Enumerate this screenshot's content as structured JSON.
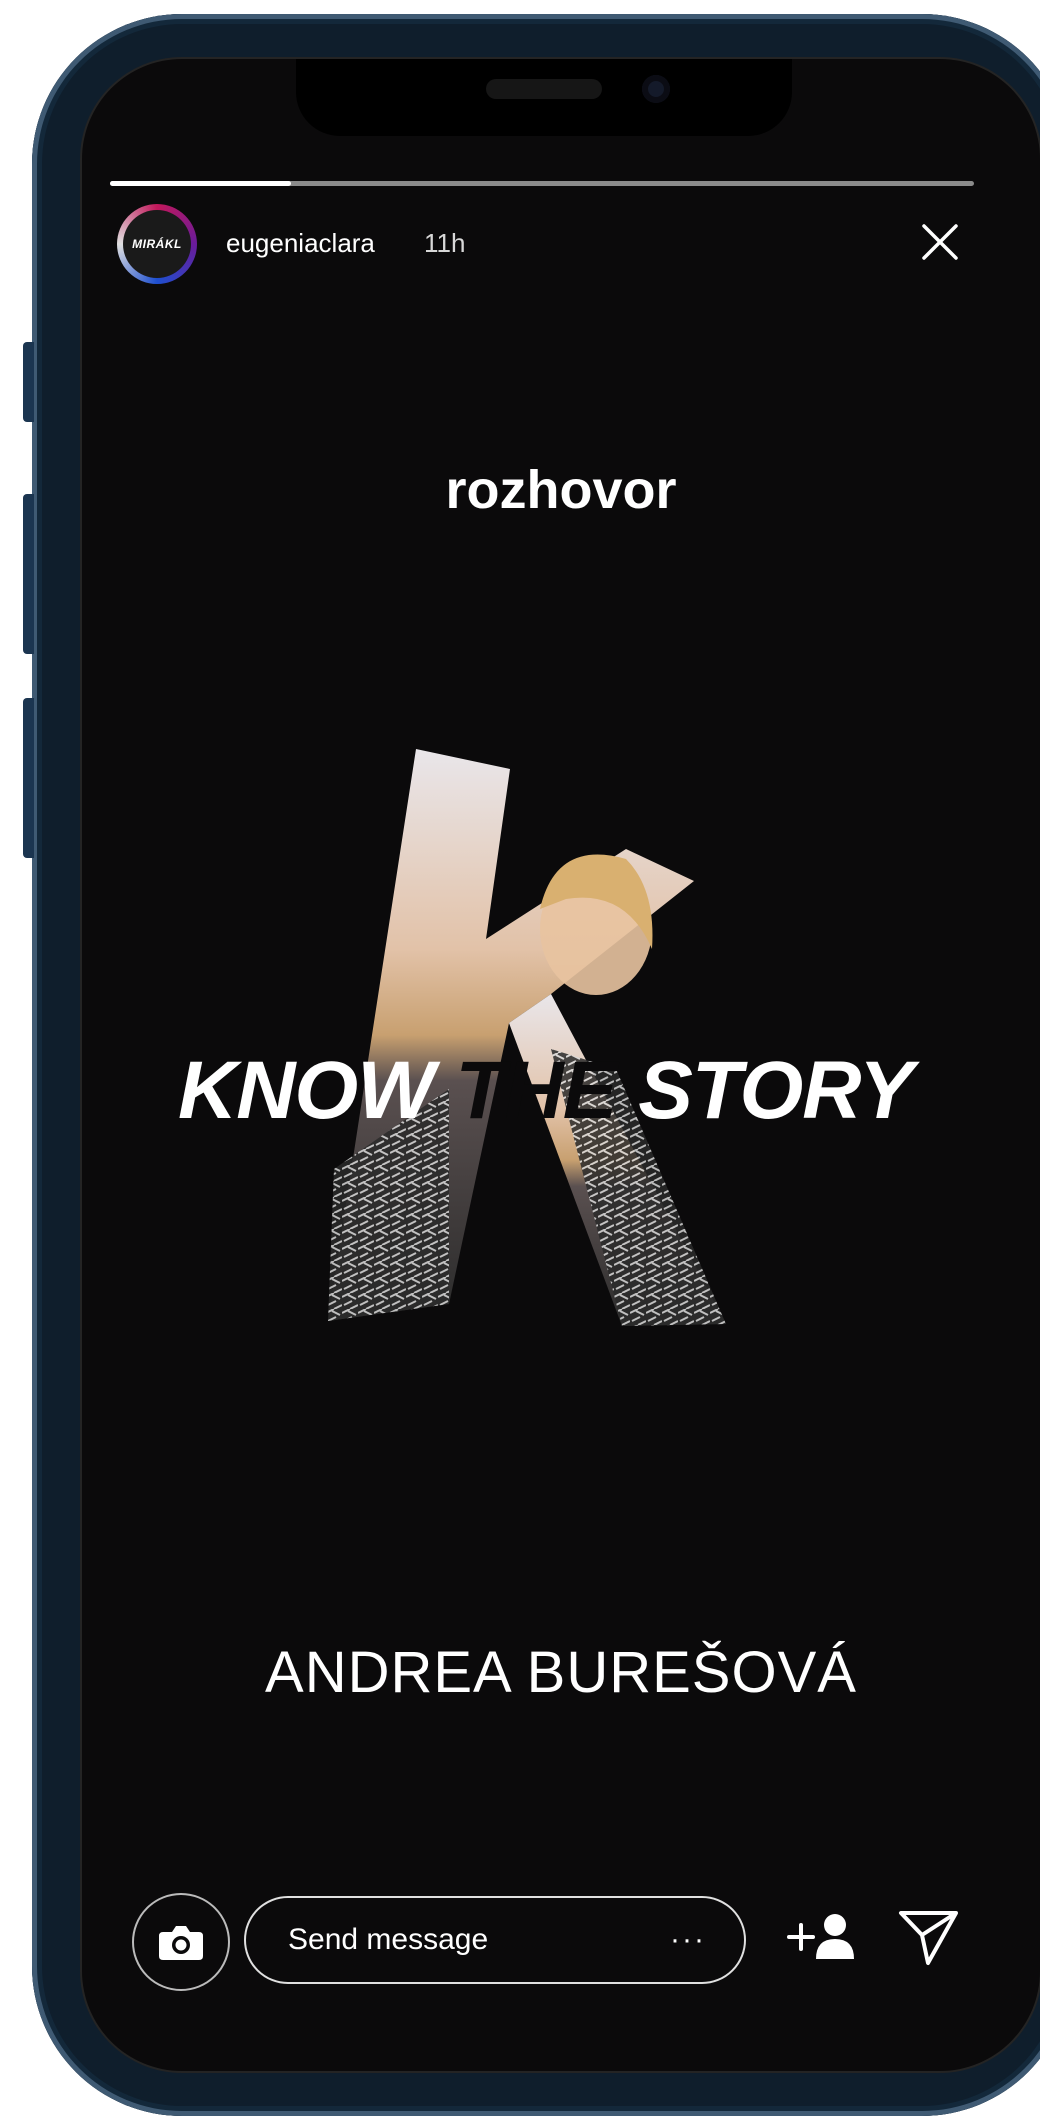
{
  "story": {
    "progress_fraction": 0.21,
    "user": {
      "avatar_text": "MIRÁKL",
      "username": "eugeniaclara",
      "time_ago": "11h"
    },
    "title": "rozhovor",
    "headline": {
      "part1": "KNOW",
      "part2": " THE",
      "part3": " STORY"
    },
    "person_name": "ANDREA BUREŠOVÁ"
  },
  "composer": {
    "placeholder": "Send message",
    "more_label": "···"
  },
  "icons": {
    "close": "close-icon",
    "camera": "camera-icon",
    "add_friend": "add-friend-icon",
    "send": "send-icon"
  },
  "colors": {
    "background": "#0b0a0b",
    "text": "#ffffff",
    "frame": "#0f1e2c"
  }
}
